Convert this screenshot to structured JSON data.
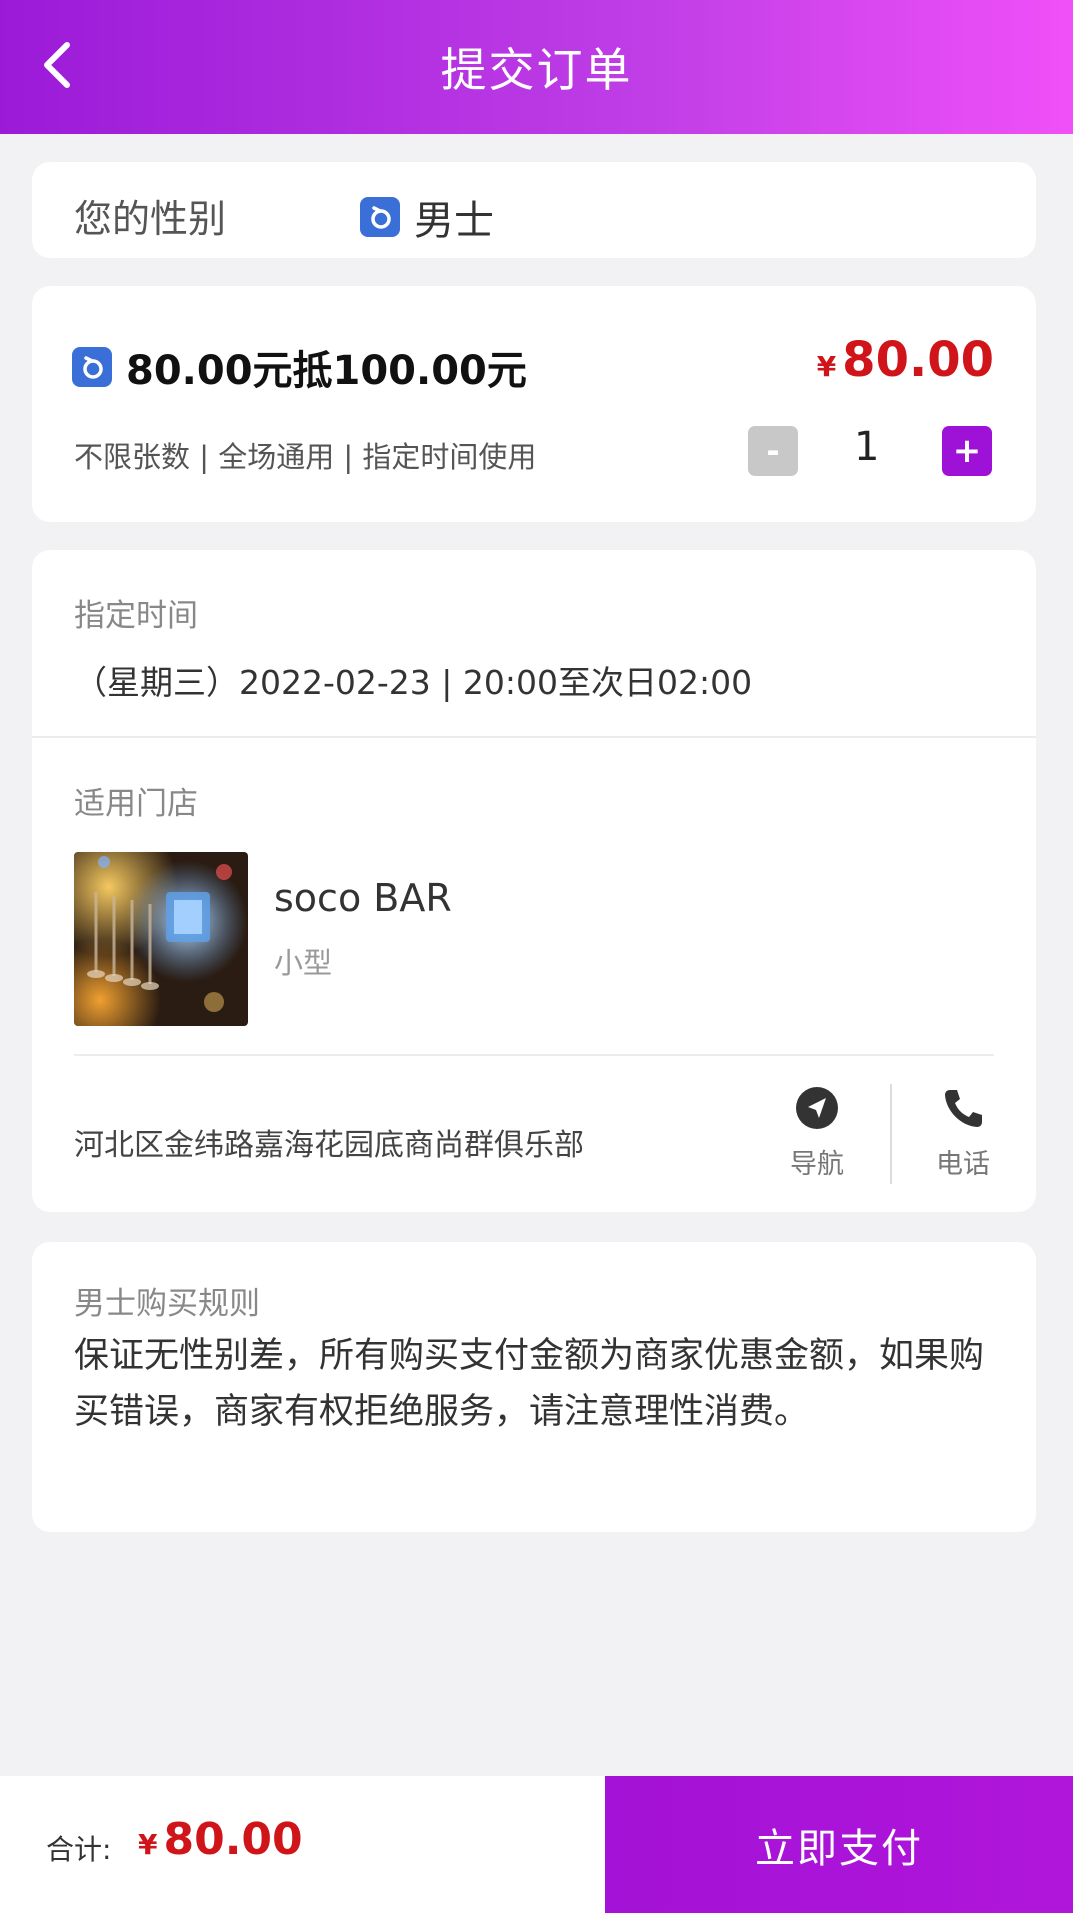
{
  "header": {
    "title": "提交订单",
    "background_gradient": [
      "#9b1ad8",
      "#f050f8"
    ]
  },
  "gender": {
    "label": "您的性别",
    "value": "男士",
    "icon": "male-icon",
    "icon_color": "#3b6fd8"
  },
  "voucher": {
    "title": "80.00元抵100.00元",
    "price_symbol": "¥",
    "price": "80.00",
    "description": "不限张数 | 全场通用 | 指定时间使用",
    "quantity": "1",
    "minus_label": "-",
    "plus_label": "+",
    "price_color": "#d0151a",
    "accent_color": "#9d12d6"
  },
  "time": {
    "label": "指定时间",
    "value": "（星期三）2022-02-23 | 20:00至次日02:00"
  },
  "store": {
    "label": "适用门店",
    "name": "soco BAR",
    "type": "小型",
    "address": "河北区金纬路嘉海花园底商尚群俱乐部",
    "nav_label": "导航",
    "phone_label": "电话"
  },
  "rules": {
    "title": "男士购买规则",
    "text": "保证无性别差，所有购买支付金额为商家优惠金额，如果购买错误，商家有权拒绝服务，请注意理性消费。"
  },
  "footer": {
    "total_label": "合计:",
    "total_symbol": "¥",
    "total_price": "80.00",
    "pay_label": "立即支付"
  }
}
